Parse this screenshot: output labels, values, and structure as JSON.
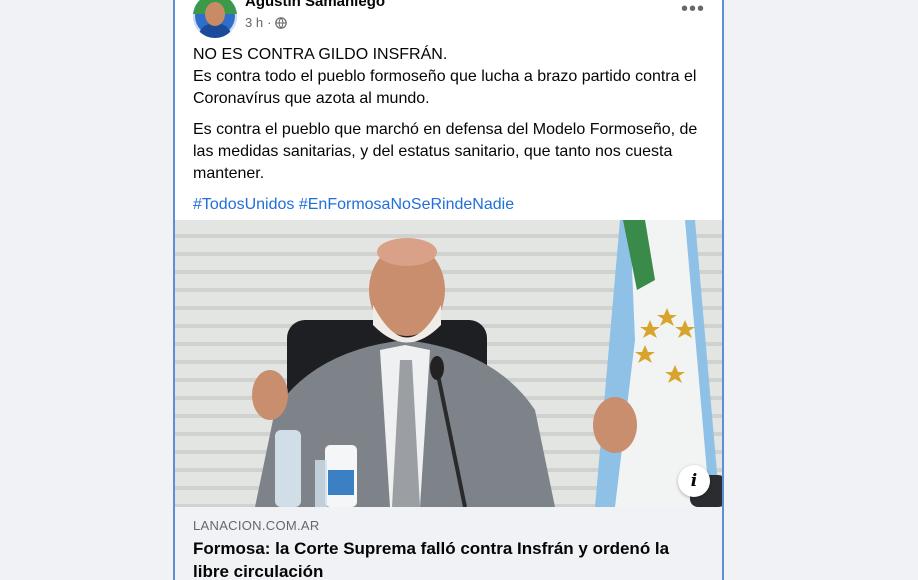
{
  "post": {
    "author": "Agustín Samaniego",
    "time": "3 h",
    "separator": "·",
    "more_label": "•••",
    "paragraphs": [
      "NO ES CONTRA GILDO INSFRÁN.",
      "Es contra todo el pueblo formoseño que lucha a brazo partido contra el Coronavírus que azota al mundo.",
      "Es contra el pueblo que marchó en defensa del Modelo Formoseño, de las medidas sanitarias, y del estatus sanitario, que tanto nos cuesta mantener."
    ],
    "hashtags": [
      "#TodosUnidos",
      "#EnFormosaNoSeRindeNadie"
    ]
  },
  "link_preview": {
    "info_label": "i",
    "domain": "LANACION.COM.AR",
    "title": "Formosa: la Corte Suprema falló contra Insfrán y ordenó la libre circulación"
  },
  "colors": {
    "link": "#216fdb",
    "card_border": "#5b8fd6",
    "secondary_text": "#65676b"
  }
}
